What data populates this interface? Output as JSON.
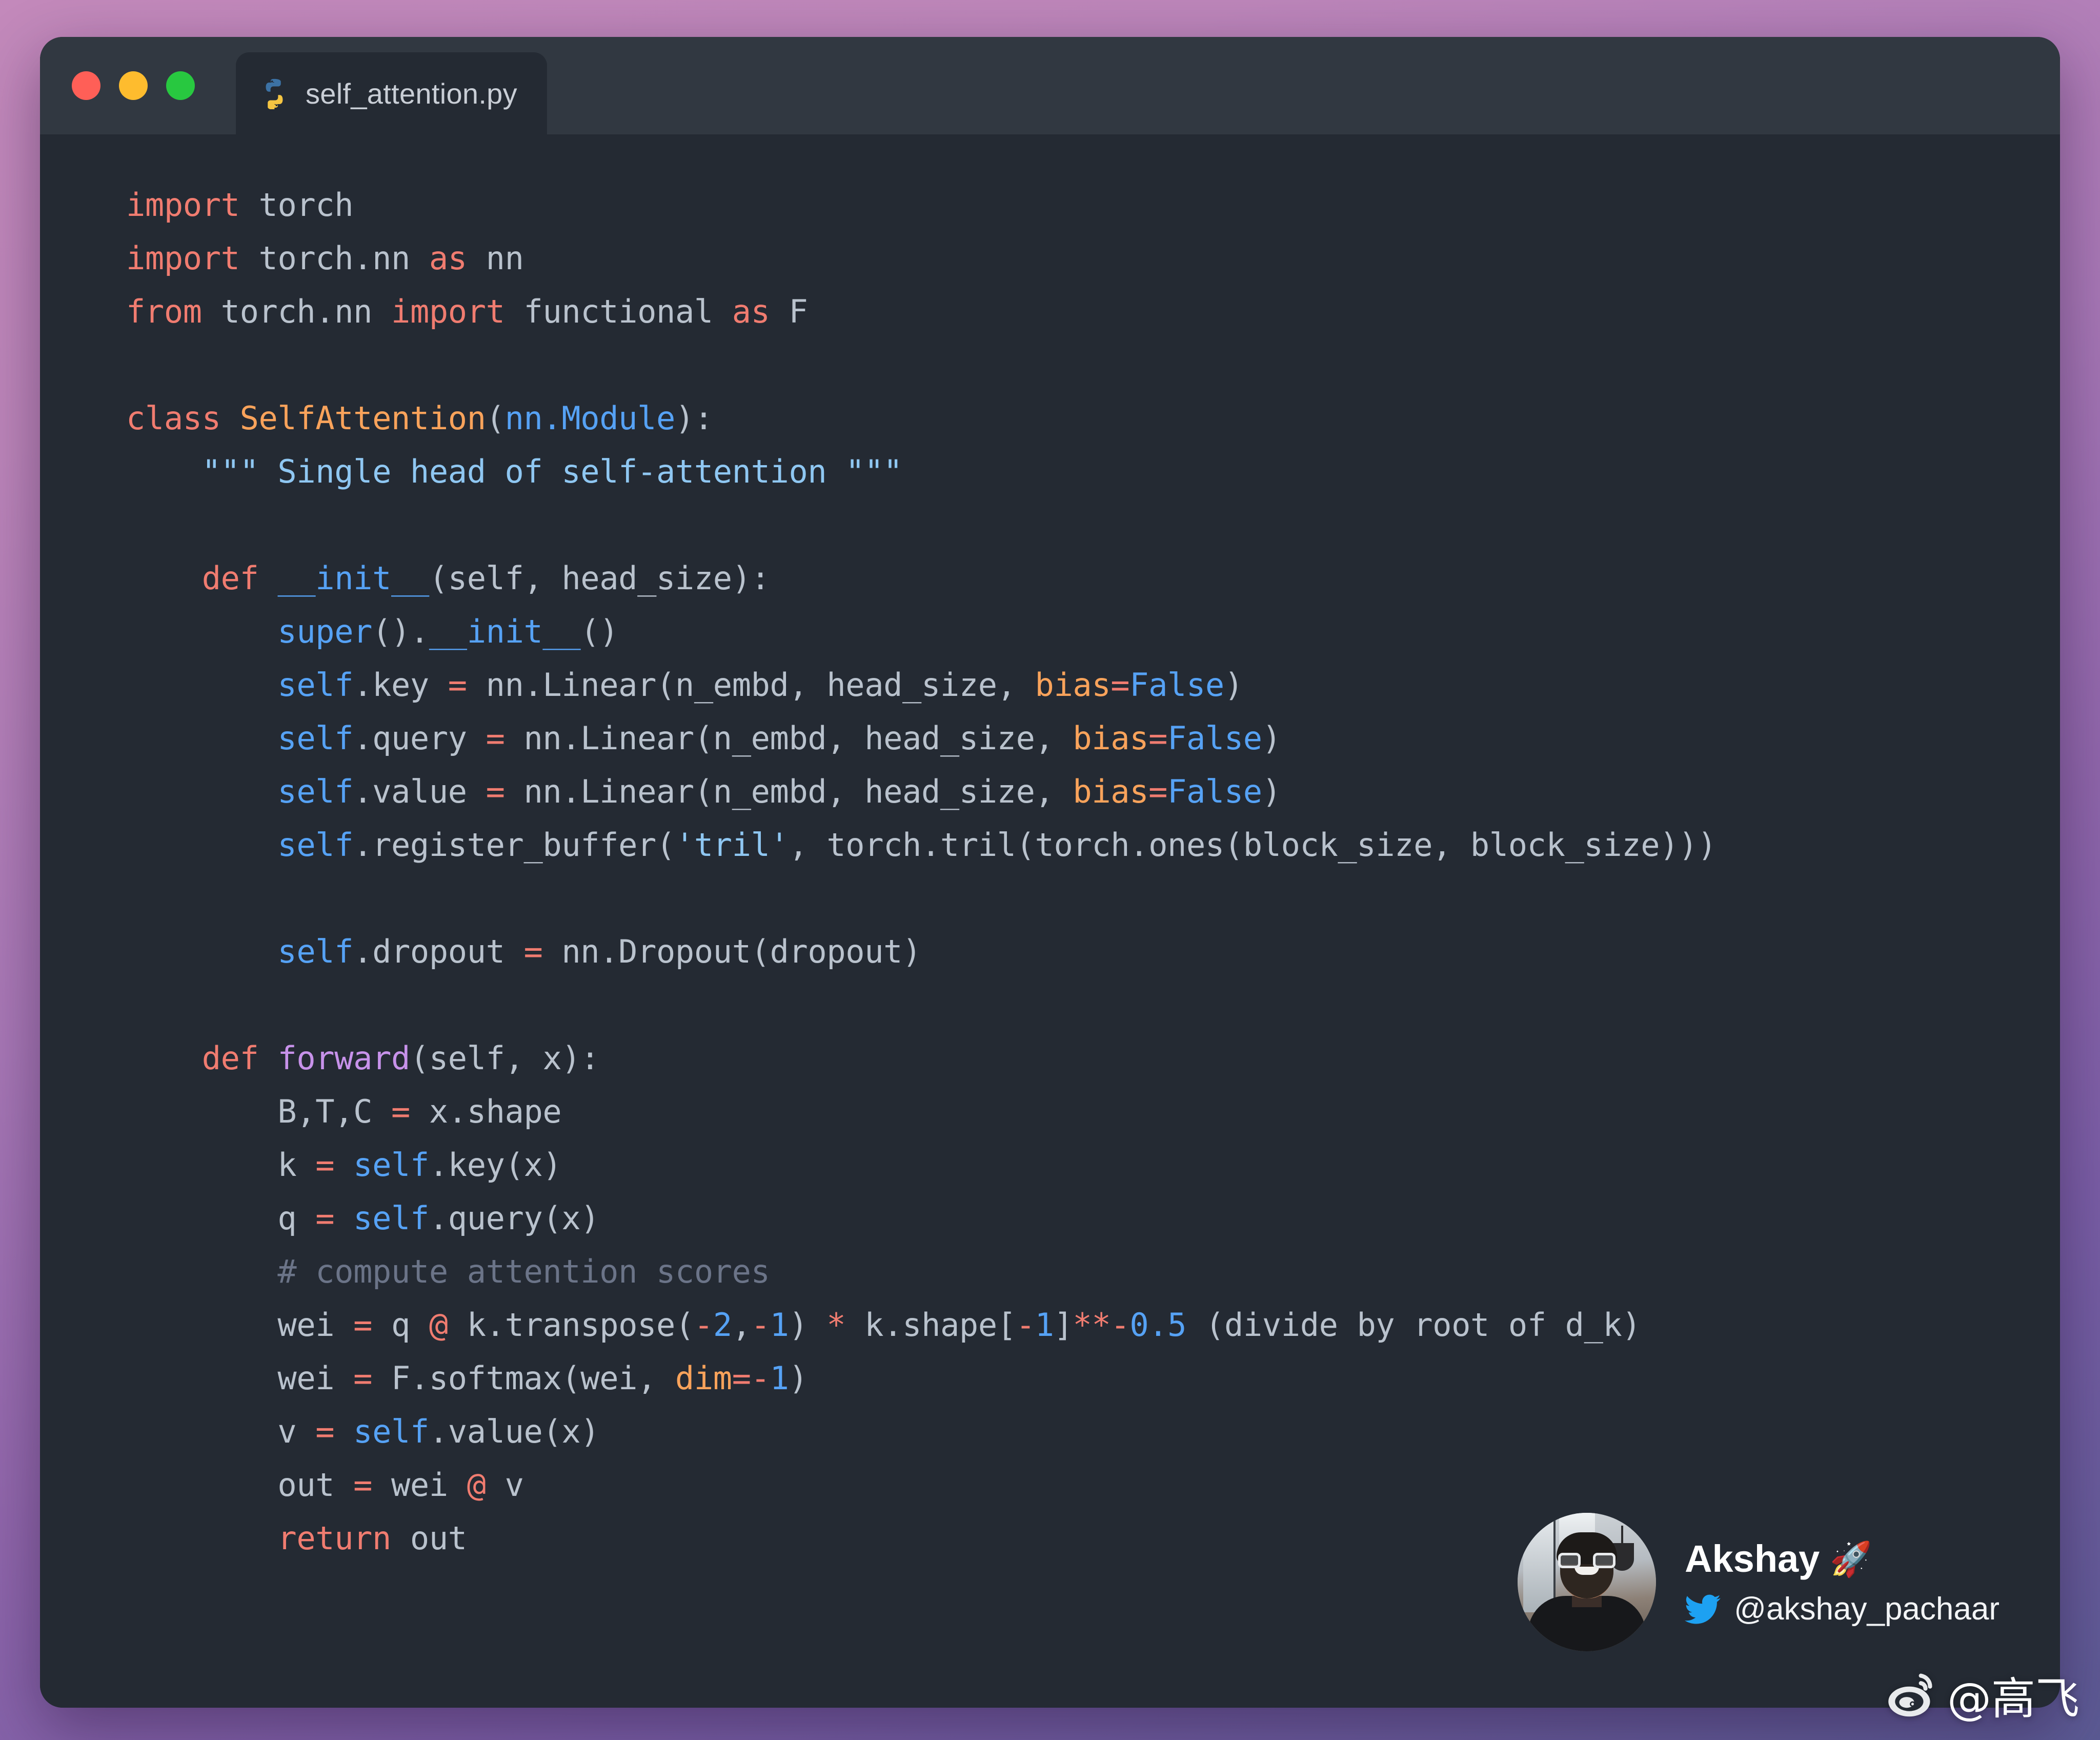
{
  "window": {
    "traffic_lights": [
      {
        "name": "close",
        "color": "#ff5f57"
      },
      {
        "name": "minimize",
        "color": "#febc2e"
      },
      {
        "name": "maximize",
        "color": "#28c840"
      }
    ],
    "tab": {
      "icon": "python-icon",
      "filename": "self_attention.py"
    },
    "background_color": "#242a33",
    "titlebar_color": "#313841"
  },
  "editor": {
    "language": "python",
    "theme_colors": {
      "keyword": "#f07c70",
      "class_name": "#f9a35b",
      "keyword_arg": "#f9a35b",
      "builtin_blue": "#56a2f5",
      "function_name": "#c792ea",
      "string": "#8fc7f2",
      "comment": "#6b7488",
      "plain": "#b9c2cd"
    },
    "code_lines": [
      "import torch",
      "import torch.nn as nn",
      "from torch.nn import functional as F",
      "",
      "class SelfAttention(nn.Module):",
      "    \"\"\" Single head of self-attention \"\"\"",
      "",
      "    def __init__(self, head_size):",
      "        super().__init__()",
      "        self.key = nn.Linear(n_embd, head_size, bias=False)",
      "        self.query = nn.Linear(n_embd, head_size, bias=False)",
      "        self.value = nn.Linear(n_embd, head_size, bias=False)",
      "        self.register_buffer('tril', torch.tril(torch.ones(block_size, block_size)))",
      "",
      "        self.dropout = nn.Dropout(dropout)",
      "",
      "    def forward(self, x):",
      "        B,T,C = x.shape",
      "        k = self.key(x)",
      "        q = self.query(x)",
      "        # compute attention scores",
      "        wei = q @ k.transpose(-2,-1) * k.shape[-1]**-0.5 (divide by root of d_k)",
      "        wei = F.softmax(wei, dim=-1)",
      "        v = self.value(x)",
      "        out = wei @ v",
      "        return out"
    ]
  },
  "profile": {
    "avatar": "user-avatar",
    "name": "Akshay",
    "name_emoji": "🚀",
    "twitter_icon": "twitter-bird-icon",
    "handle": "@akshay_pachaar"
  },
  "watermark": {
    "icon": "weibo-icon",
    "text": "@高飞"
  }
}
